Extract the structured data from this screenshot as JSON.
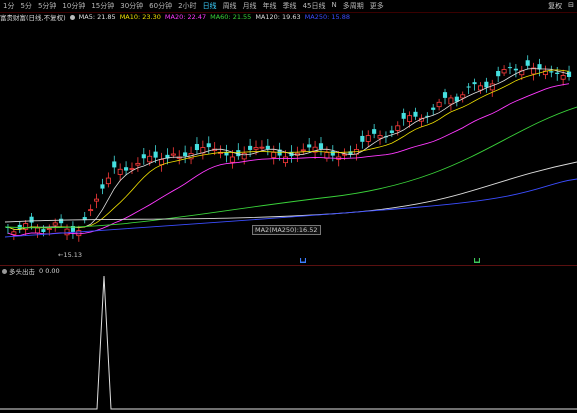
{
  "toolbar": {
    "timeframes": [
      "1分",
      "5分",
      "5分钟",
      "10分钟",
      "15分钟",
      "30分钟",
      "60分钟",
      "2小时",
      "日线",
      "周线",
      "月线",
      "年线",
      "季线",
      "45日线",
      "N",
      "多周期",
      "更多"
    ],
    "active_timeframe": "日线",
    "right_buttons": [
      "复权",
      "⊟"
    ]
  },
  "indicators": {
    "main_name": "富贵财富(日线,不复权)",
    "ma_labels": [
      {
        "text": "MA5: 21.85",
        "color": "#e0e0e0"
      },
      {
        "text": "MA10: 23.30",
        "color": "#f0e000"
      },
      {
        "text": "MA20: 22.47",
        "color": "#ff39ff"
      },
      {
        "text": "MA60: 21.55",
        "color": "#3ad23a"
      },
      {
        "text": "MA120: 19.63",
        "color": "#dcdcdc"
      },
      {
        "text": "MA250: 15.88",
        "color": "#3b4dff"
      }
    ]
  },
  "tooltip": "MA2(MA250):16.52",
  "low_label": "←15.13",
  "sub_indicator": {
    "name": "多头出击",
    "values": "0 0.00"
  },
  "colors": {
    "up": "#ff3c3c",
    "down": "#45e0e0",
    "bg": "#000000"
  }
}
